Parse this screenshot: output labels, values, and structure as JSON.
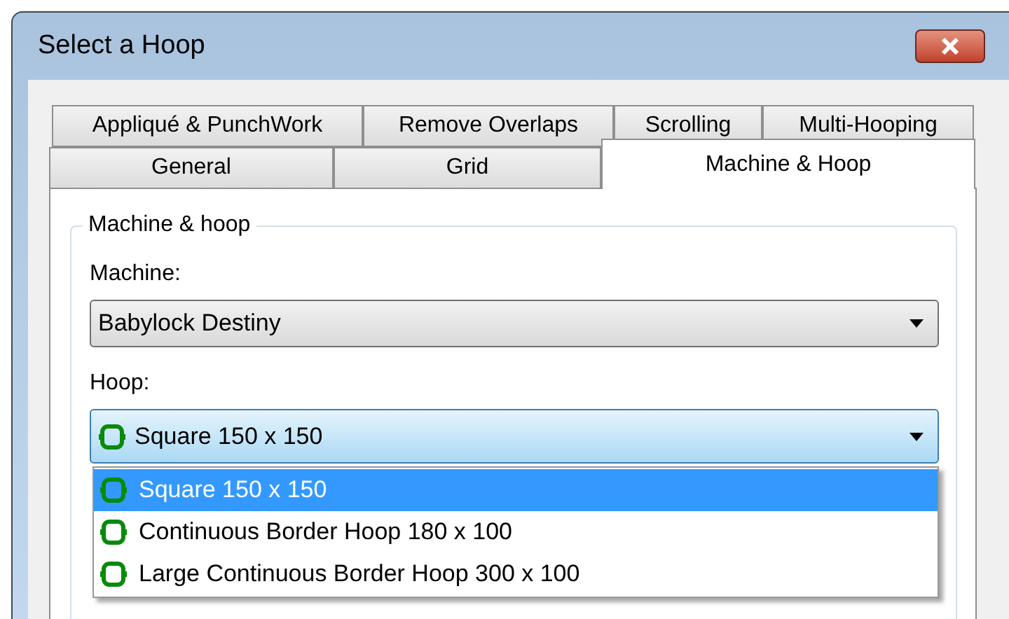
{
  "window": {
    "title": "Select a Hoop"
  },
  "tab_rows": [
    [
      {
        "label": "Appliqué & PunchWork",
        "selected": false
      },
      {
        "label": "Remove Overlaps",
        "selected": false
      },
      {
        "label": "Scrolling",
        "selected": false
      },
      {
        "label": "Multi-Hooping",
        "selected": false
      }
    ],
    [
      {
        "label": "General",
        "selected": false
      },
      {
        "label": "Grid",
        "selected": false
      },
      {
        "label": "Machine & Hoop",
        "selected": true
      }
    ]
  ],
  "group": {
    "title": "Machine & hoop",
    "machine": {
      "label": "Machine:",
      "value": "Babylock Destiny"
    },
    "hoop": {
      "label": "Hoop:",
      "value": "Square 150 x 150",
      "expanded": true,
      "options": [
        {
          "label": "Square 150 x 150",
          "selected": true
        },
        {
          "label": "Continuous Border Hoop 180 x 100",
          "selected": false
        },
        {
          "label": "Large Continuous Border Hoop 300 x 100",
          "selected": false
        }
      ]
    }
  }
}
